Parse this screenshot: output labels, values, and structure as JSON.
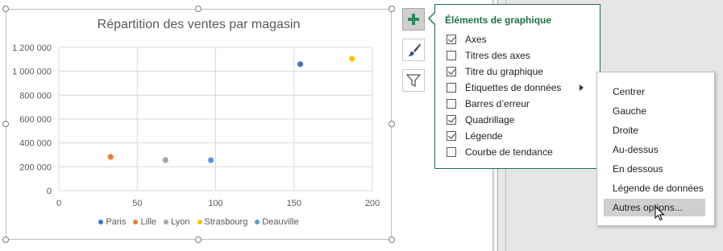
{
  "chart": {
    "title": "Répartition des ventes par magasin"
  },
  "chart_data": {
    "type": "scatter",
    "title": "Répartition des ventes par magasin",
    "xlabel": "",
    "ylabel": "",
    "xlim": [
      0,
      200
    ],
    "ylim": [
      0,
      1200000
    ],
    "x_ticks": [
      "0",
      "50",
      "100",
      "150",
      "200"
    ],
    "y_ticks": [
      "0",
      "200 000",
      "400 000",
      "600 000",
      "800 000",
      "1 000 000",
      "1 200 000"
    ],
    "grid": true,
    "legend_position": "bottom",
    "series": [
      {
        "name": "Paris",
        "color": "#4472c4",
        "x": [
          154
        ],
        "y": [
          1060000
        ]
      },
      {
        "name": "Lille",
        "color": "#ed7d31",
        "x": [
          33
        ],
        "y": [
          283000
        ]
      },
      {
        "name": "Lyon",
        "color": "#a5a5a5",
        "x": [
          68
        ],
        "y": [
          256000
        ]
      },
      {
        "name": "Strasbourg",
        "color": "#ffc000",
        "x": [
          187
        ],
        "y": [
          1105000
        ]
      },
      {
        "name": "Deauville",
        "color": "#5b9bd5",
        "x": [
          97
        ],
        "y": [
          256000
        ]
      }
    ]
  },
  "side_buttons": [
    {
      "icon": "plus-icon"
    },
    {
      "icon": "paintbrush-icon"
    },
    {
      "icon": "filter-icon"
    }
  ],
  "panel": {
    "title": "Éléments de graphique",
    "options": [
      {
        "label": "Axes",
        "checked": true
      },
      {
        "label": "Titres des axes",
        "checked": false
      },
      {
        "label": "Titre du graphique",
        "checked": true
      },
      {
        "label": "Étiquettes de données",
        "checked": false,
        "has_submenu": true
      },
      {
        "label": "Barres d’erreur",
        "checked": false
      },
      {
        "label": "Quadrillage",
        "checked": true
      },
      {
        "label": "Légende",
        "checked": true
      },
      {
        "label": "Courbe de tendance",
        "checked": false
      }
    ]
  },
  "submenu": {
    "items": [
      "Centrer",
      "Gauche",
      "Droite",
      "Au-dessus",
      "En dessous",
      "Légende de données",
      "Autres options..."
    ],
    "highlighted": 6
  },
  "colors": {
    "accent": "#1e7145",
    "gridline": "#d9d9d9",
    "axis_text": "#595959"
  }
}
